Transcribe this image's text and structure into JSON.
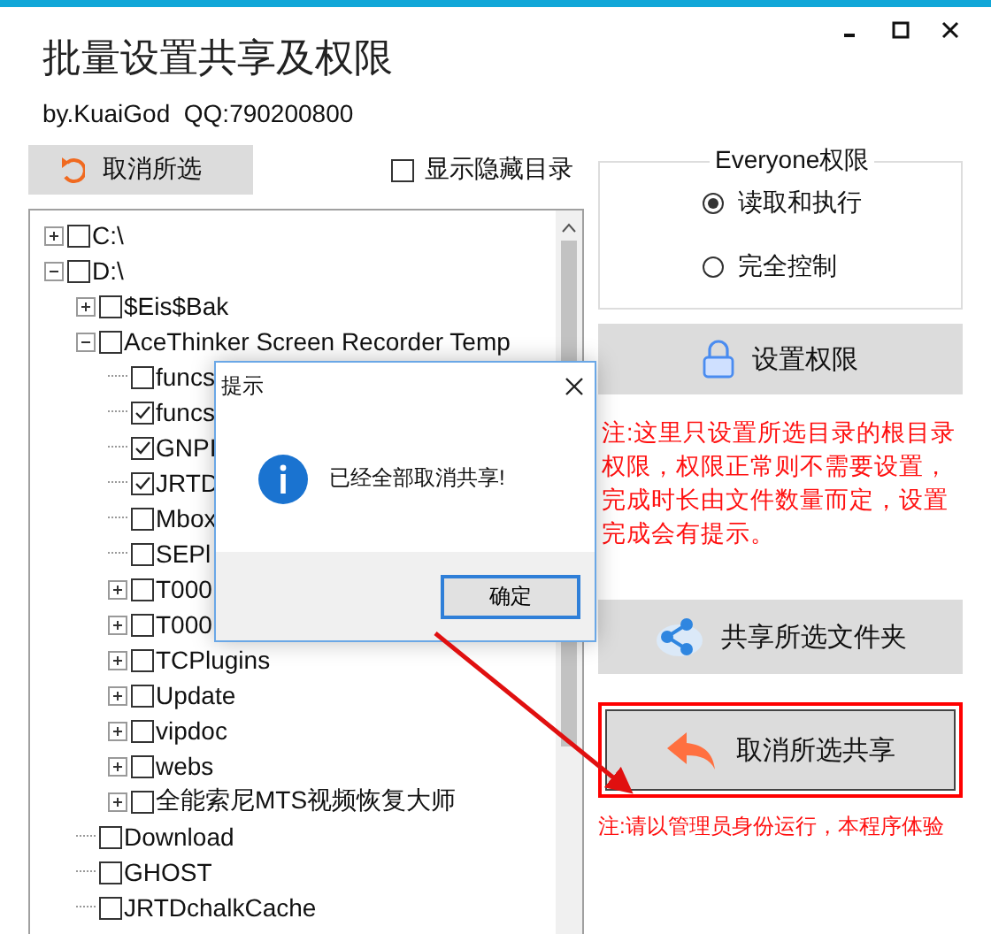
{
  "window": {
    "title": "批量设置共享及权限",
    "subtitle": "by.KuaiGod  QQ:790200800"
  },
  "toolbar": {
    "clear_button": "取消所选",
    "show_hidden": {
      "label": "显示隐藏目录",
      "checked": false
    }
  },
  "tree": [
    {
      "label": "C:\\",
      "kind": "collapsed",
      "checked": false
    },
    {
      "label": "D:\\",
      "kind": "expanded",
      "checked": false,
      "children": [
        {
          "label": "$Eis$Bak",
          "kind": "collapsed",
          "checked": false
        },
        {
          "label": "AceThinker Screen Recorder Temp",
          "kind": "expanded",
          "checked": false,
          "children": [
            {
              "label": "funcs",
              "kind": "leaf",
              "checked": false
            },
            {
              "label": "funcs",
              "kind": "leaf",
              "checked": true
            },
            {
              "label": "GNPI",
              "kind": "leaf",
              "checked": true
            },
            {
              "label": "JRTD",
              "kind": "leaf",
              "checked": true
            },
            {
              "label": "Mbox",
              "kind": "leaf",
              "checked": false
            },
            {
              "label": "SEPl",
              "kind": "leaf",
              "checked": false
            },
            {
              "label": "T000",
              "kind": "collapsed",
              "checked": false
            },
            {
              "label": "T000",
              "kind": "collapsed",
              "checked": false
            },
            {
              "label": "TCPlugins",
              "kind": "collapsed",
              "checked": false
            },
            {
              "label": "Update",
              "kind": "collapsed",
              "checked": false
            },
            {
              "label": "vipdoc",
              "kind": "collapsed",
              "checked": false
            },
            {
              "label": "webs",
              "kind": "collapsed",
              "checked": false
            },
            {
              "label": "全能索尼MTS视频恢复大师",
              "kind": "collapsed",
              "checked": false
            }
          ]
        },
        {
          "label": "Download",
          "kind": "leaf",
          "checked": false
        },
        {
          "label": "GHOST",
          "kind": "leaf",
          "checked": false
        },
        {
          "label": "JRTDchalkCache",
          "kind": "leaf",
          "checked": false
        }
      ]
    }
  ],
  "permissions": {
    "title": "Everyone权限",
    "options": [
      {
        "label": "读取和执行",
        "selected": true
      },
      {
        "label": "完全控制",
        "selected": false
      }
    ]
  },
  "set_button": "设置权限",
  "note": "注:这里只设置所选目录的根目录权限，权限正常则不需要设置，完成时长由文件数量而定，设置完成会有提示。",
  "share_button": "共享所选文件夹",
  "unshare_button": {
    "label": "取消所选共享",
    "highlighted": true
  },
  "footer_note": "注:请以管理员身份运行，本程序体验",
  "dialog": {
    "title": "提示",
    "message": "已经全部取消共享!",
    "button": "确定"
  }
}
